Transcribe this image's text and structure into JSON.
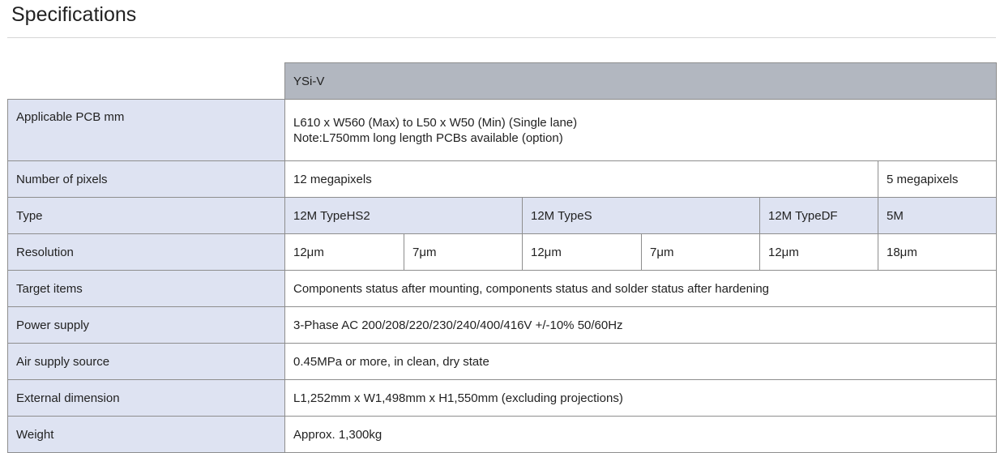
{
  "page": {
    "title": "Specifications"
  },
  "table": {
    "model": "YSi-V",
    "rows": {
      "pcb": {
        "label": "Applicable PCB mm",
        "line1": "L610 x W560 (Max) to L50 x W50 (Min) (Single lane)",
        "line2": "Note:L750mm long length PCBs available (option)"
      },
      "pixels": {
        "label": "Number of pixels",
        "values": [
          "12 megapixels",
          "5 megapixels"
        ]
      },
      "type": {
        "label": "Type",
        "values": [
          "12M TypeHS2",
          "12M TypeS",
          "12M TypeDF",
          "5M"
        ]
      },
      "resolution": {
        "label": "Resolution",
        "values": [
          "12μm",
          "7μm",
          "12μm",
          "7μm",
          "12μm",
          "18μm"
        ]
      },
      "target": {
        "label": "Target items",
        "value": "Components status after mounting, components status and solder status after hardening"
      },
      "power": {
        "label": "Power supply",
        "value": "3-Phase AC 200/208/220/230/240/400/416V +/-10% 50/60Hz"
      },
      "air": {
        "label": "Air supply source",
        "value": "0.45MPa or more, in clean, dry state"
      },
      "dimension": {
        "label": "External dimension",
        "value": "L1,252mm x W1,498mm x H1,550mm (excluding projections)"
      },
      "weight": {
        "label": "Weight",
        "value": "Approx. 1,300kg"
      }
    }
  }
}
